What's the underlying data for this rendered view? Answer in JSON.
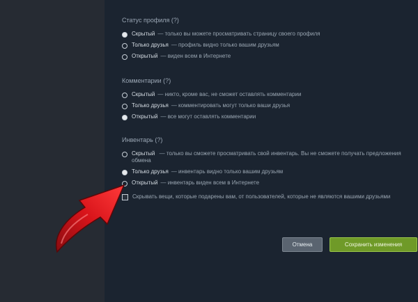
{
  "sections": [
    {
      "title": "Статус профиля (?)",
      "options": [
        {
          "label": "Скрытый",
          "desc": "— только вы можете просматривать страницу своего профиля",
          "selected": true
        },
        {
          "label": "Только друзья",
          "desc": "— профиль видно только вашим друзьям",
          "selected": false
        },
        {
          "label": "Открытый",
          "desc": "— виден всем в Интернете",
          "selected": false
        }
      ]
    },
    {
      "title": "Комментарии (?)",
      "options": [
        {
          "label": "Скрытый",
          "desc": "— никто, кроме вас, не сможет оставлять комментарии",
          "selected": false
        },
        {
          "label": "Только друзья",
          "desc": "— комментировать могут только ваши друзья",
          "selected": false
        },
        {
          "label": "Открытый",
          "desc": "— все могут оставлять комментарии",
          "selected": true
        }
      ]
    },
    {
      "title": "Инвентарь (?)",
      "options": [
        {
          "label": "Скрытый",
          "desc": "— только вы сможете просматривать свой инвентарь. Вы не сможете получать предложения обмена",
          "selected": false
        },
        {
          "label": "Только друзья",
          "desc": "— инвентарь видно только вашим друзьям",
          "selected": true
        },
        {
          "label": "Открытый",
          "desc": "— инвентарь виден всем в Интернете",
          "selected": false
        }
      ],
      "checkbox": {
        "label": "Скрывать вещи, которые подарены вам, от пользователей, которые не являются вашими друзьями",
        "checked": false
      }
    }
  ],
  "buttons": {
    "cancel": "Отмена",
    "save": "Сохранить изменения"
  },
  "colors": {
    "arrow": "#d8141a",
    "save_button": "#6f9a28",
    "panel": "#1b2430"
  },
  "icons": {
    "pointer": "red-arrow-icon"
  }
}
